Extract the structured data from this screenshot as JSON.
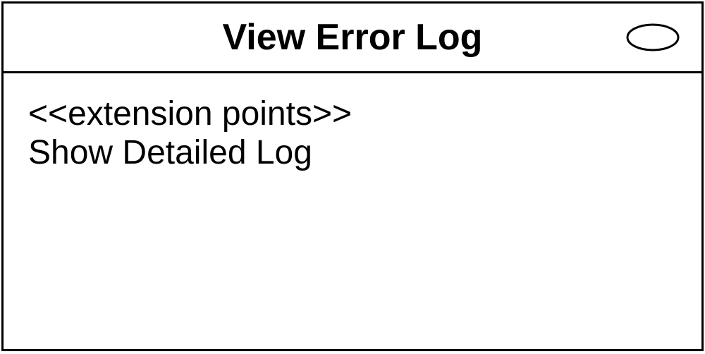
{
  "useCase": {
    "title": "View Error Log",
    "stereotype": "<<extension points>>",
    "extensionPoint": "Show Detailed Log"
  }
}
